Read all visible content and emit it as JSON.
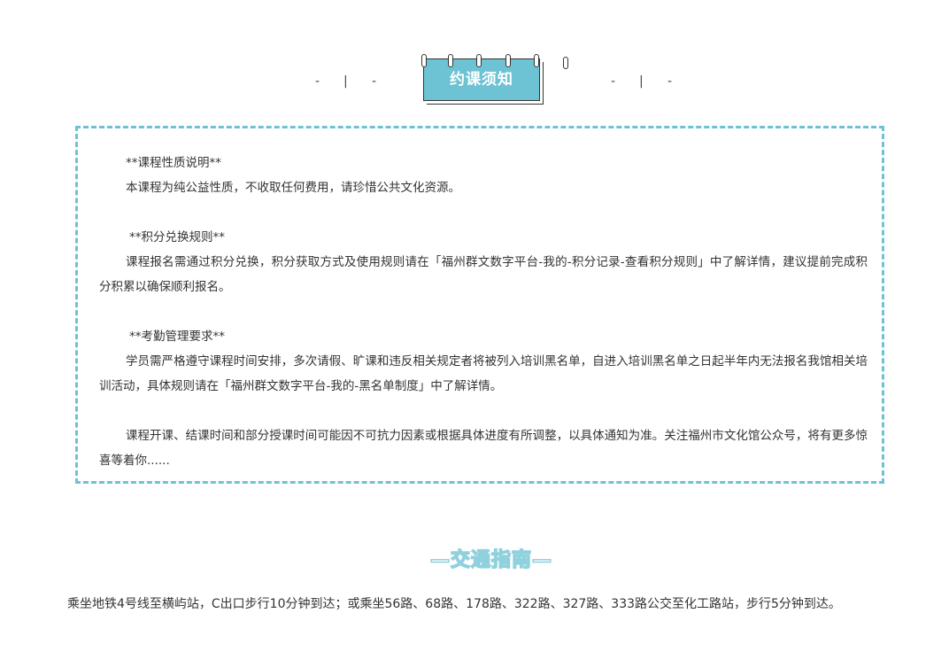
{
  "notice": {
    "title": "约课须知",
    "decor_left": [
      "-",
      "|",
      "-"
    ],
    "decor_right": [
      "-",
      "|",
      "-"
    ],
    "sections": [
      {
        "heading": "**课程性质说明**",
        "body": "本课程为纯公益性质，不收取任何费用，请珍惜公共文化资源。"
      },
      {
        "heading": " **积分兑换规则**",
        "body": "课程报名需通过积分兑换，积分获取方式及使用规则请在「福州群文数字平台-我的-积分记录-查看积分规则」中了解详情，建议提前完成积分积累以确保顺利报名。"
      },
      {
        "heading": " **考勤管理要求**",
        "body": "学员需严格遵守课程时间安排，多次请假、旷课和违反相关规定者将被列入培训黑名单，自进入培训黑名单之日起半年内无法报名我馆相关培训活动，具体规则请在「福州群文数字平台-我的-黑名单制度」中了解详情。"
      },
      {
        "heading": "",
        "body": "课程开课、结课时间和部分授课时间可能因不可抗力因素或根据具体进度有所调整，以具体通知为准。关注福州市文化馆公众号，将有更多惊喜等着你......"
      }
    ]
  },
  "traffic": {
    "title": "—交通指南—",
    "body": "乘坐地铁4号线至横屿站，C出口步行10分钟到达；或乘坐56路、68路、178路、322路、327路、333路公交至化工路站，步行5分钟到达。"
  },
  "colors": {
    "accent": "#6dc3d3",
    "text": "#333333"
  }
}
